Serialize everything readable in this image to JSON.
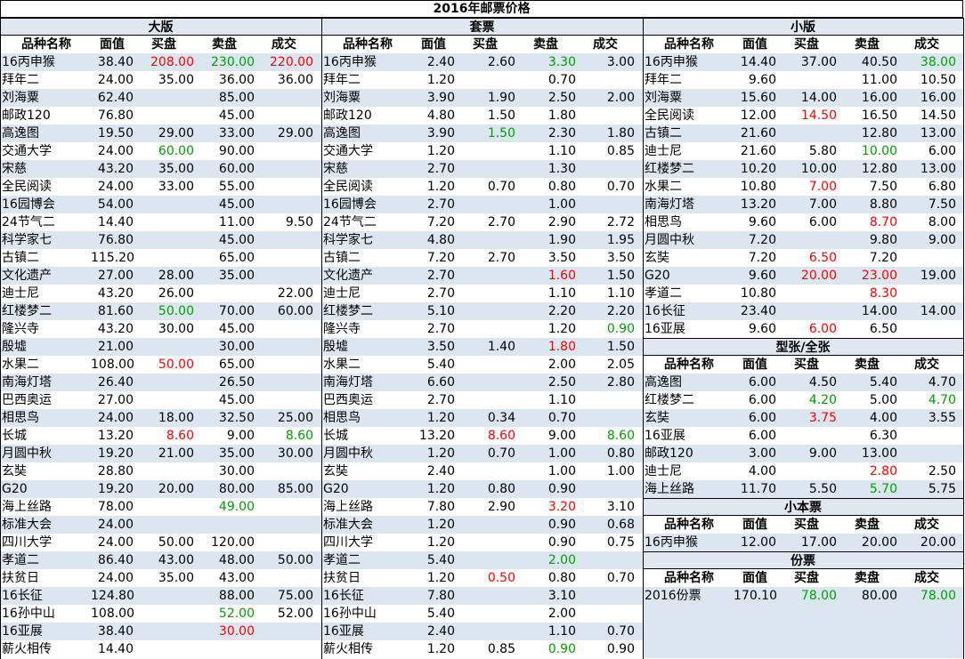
{
  "title": "2016年邮票价格",
  "headers": [
    "品种名称",
    "面值",
    "买盘",
    "卖盘",
    "成交"
  ],
  "left": {
    "section": "大版",
    "rows": [
      [
        "16丙申猴",
        "38.40",
        [
          "208.00",
          "red"
        ],
        [
          "230.00",
          "green"
        ],
        [
          "220.00",
          "red"
        ]
      ],
      [
        "拜年二",
        "24.00",
        "35.00",
        "36.00",
        "36.00"
      ],
      [
        "刘海粟",
        "62.40",
        "",
        "85.00",
        ""
      ],
      [
        "邮政120",
        "76.80",
        "",
        "45.00",
        ""
      ],
      [
        "高逸图",
        "19.50",
        "29.00",
        "33.00",
        "29.00"
      ],
      [
        "交通大学",
        "24.00",
        [
          "60.00",
          "green"
        ],
        "90.00",
        ""
      ],
      [
        "宋慈",
        "43.20",
        "35.00",
        "60.00",
        ""
      ],
      [
        "全民阅读",
        "24.00",
        "33.00",
        "55.00",
        ""
      ],
      [
        "16园博会",
        "54.00",
        "",
        "45.00",
        ""
      ],
      [
        "24节气二",
        "14.40",
        "",
        "11.00",
        "9.50"
      ],
      [
        "科学家七",
        "76.80",
        "",
        "45.00",
        ""
      ],
      [
        "古镇二",
        "115.20",
        "",
        "65.00",
        ""
      ],
      [
        "文化遗产",
        "27.00",
        "28.00",
        "35.00",
        ""
      ],
      [
        "迪士尼",
        "43.20",
        "26.00",
        "",
        "22.00"
      ],
      [
        "红楼梦二",
        "81.60",
        [
          "50.00",
          "green"
        ],
        "70.00",
        "60.00"
      ],
      [
        "隆兴寺",
        "43.20",
        "30.00",
        "45.00",
        ""
      ],
      [
        "殷墟",
        "21.00",
        "",
        "30.00",
        ""
      ],
      [
        "水果二",
        "108.00",
        [
          "50.00",
          "red"
        ],
        "65.00",
        ""
      ],
      [
        "南海灯塔",
        "26.40",
        "",
        "26.50",
        ""
      ],
      [
        "巴西奥运",
        "27.00",
        "",
        "45.00",
        ""
      ],
      [
        "相思鸟",
        "24.00",
        "18.00",
        "32.50",
        "25.00"
      ],
      [
        "长城",
        "13.20",
        [
          "8.60",
          "red"
        ],
        "9.00",
        [
          "8.60",
          "green"
        ]
      ],
      [
        "月圆中秋",
        "19.20",
        "21.00",
        "35.00",
        "30.00"
      ],
      [
        "玄奘",
        "28.80",
        "",
        "30.00",
        ""
      ],
      [
        "G20",
        "19.20",
        "20.00",
        "80.00",
        "85.00"
      ],
      [
        "海上丝路",
        "78.00",
        "",
        [
          "49.00",
          "green"
        ],
        ""
      ],
      [
        "标准大会",
        "24.00",
        "",
        "",
        ""
      ],
      [
        "四川大学",
        "24.00",
        "50.00",
        "120.00",
        ""
      ],
      [
        "孝道二",
        "86.40",
        "43.00",
        "48.00",
        "50.00"
      ],
      [
        "扶贫日",
        "24.00",
        "35.00",
        "43.00",
        ""
      ],
      [
        "16长征",
        "124.80",
        "",
        "88.00",
        "75.00"
      ],
      [
        "16孙中山",
        "108.00",
        "",
        [
          "52.00",
          "green"
        ],
        "52.00"
      ],
      [
        "16亚展",
        "38.40",
        "",
        [
          "30.00",
          "red"
        ],
        ""
      ],
      [
        "薪火相传",
        "14.40",
        "",
        "",
        ""
      ]
    ]
  },
  "middle": {
    "section": "套票",
    "rows": [
      [
        "16丙申猴",
        "2.40",
        "2.60",
        [
          "3.30",
          "green"
        ],
        "3.00"
      ],
      [
        "拜年二",
        "1.20",
        "",
        "0.70",
        ""
      ],
      [
        "刘海粟",
        "3.90",
        "1.90",
        "2.50",
        "2.00"
      ],
      [
        "邮政120",
        "4.80",
        "1.50",
        "1.80",
        ""
      ],
      [
        "高逸图",
        "3.90",
        [
          "1.50",
          "green"
        ],
        "2.30",
        "1.80"
      ],
      [
        "交通大学",
        "1.20",
        "",
        "1.10",
        "0.85"
      ],
      [
        "宋慈",
        "2.70",
        "",
        "1.30",
        ""
      ],
      [
        "全民阅读",
        "1.20",
        "0.70",
        "0.80",
        "0.70"
      ],
      [
        "16园博会",
        "2.70",
        "",
        "1.00",
        ""
      ],
      [
        "24节气二",
        "7.20",
        "2.70",
        "2.90",
        "2.72"
      ],
      [
        "科学家七",
        "4.80",
        "",
        "1.90",
        "1.95"
      ],
      [
        "古镇二",
        "7.20",
        "2.70",
        "3.50",
        "3.50"
      ],
      [
        "文化遗产",
        "2.70",
        "",
        [
          "1.60",
          "red"
        ],
        "1.50"
      ],
      [
        "迪士尼",
        "2.70",
        "",
        "1.10",
        "1.10"
      ],
      [
        "红楼梦二",
        "5.10",
        "",
        "2.20",
        "2.20"
      ],
      [
        "隆兴寺",
        "2.70",
        "",
        "1.20",
        [
          "0.90",
          "green"
        ]
      ],
      [
        "殷墟",
        "3.50",
        "1.40",
        [
          "1.80",
          "red"
        ],
        "1.50"
      ],
      [
        "水果二",
        "5.40",
        "",
        "2.00",
        "2.05"
      ],
      [
        "南海灯塔",
        "6.60",
        "",
        "2.50",
        "2.80"
      ],
      [
        "巴西奥运",
        "2.70",
        "",
        "1.10",
        ""
      ],
      [
        "相思鸟",
        "1.20",
        "0.34",
        "0.70",
        ""
      ],
      [
        "长城",
        "13.20",
        [
          "8.60",
          "red"
        ],
        "9.00",
        [
          "8.60",
          "green"
        ]
      ],
      [
        "月圆中秋",
        "1.20",
        "0.70",
        "1.00",
        "0.80"
      ],
      [
        "玄奘",
        "2.40",
        "",
        "1.00",
        "1.00"
      ],
      [
        "G20",
        "1.20",
        "0.80",
        "0.90",
        ""
      ],
      [
        "海上丝路",
        "7.80",
        "2.90",
        [
          "3.20",
          "red"
        ],
        "3.10"
      ],
      [
        "标准大会",
        "1.20",
        "",
        "0.90",
        "0.68"
      ],
      [
        "四川大学",
        "1.20",
        "",
        "0.90",
        "0.75"
      ],
      [
        "孝道二",
        "5.40",
        "",
        [
          "2.00",
          "green"
        ],
        ""
      ],
      [
        "扶贫日",
        "1.20",
        [
          "0.50",
          "red"
        ],
        "0.80",
        "0.70"
      ],
      [
        "16长征",
        "7.80",
        "",
        "3.10",
        ""
      ],
      [
        "16孙中山",
        "5.40",
        "",
        "2.00",
        ""
      ],
      [
        "16亚展",
        "2.40",
        "",
        "1.10",
        "0.70"
      ],
      [
        "薪火相传",
        "1.20",
        "0.85",
        [
          "0.90",
          "green"
        ],
        "0.90"
      ]
    ]
  },
  "right": {
    "small": {
      "section": "小版",
      "rows": [
        [
          "16丙申猴",
          "14.40",
          "37.00",
          "40.50",
          [
            "38.00",
            "green"
          ]
        ],
        [
          "拜年二",
          "9.60",
          "",
          "11.00",
          "10.50"
        ],
        [
          "刘海粟",
          "15.60",
          "14.00",
          "16.00",
          "16.00"
        ],
        [
          "全民阅读",
          "12.00",
          [
            "14.50",
            "red"
          ],
          "16.50",
          "14.50"
        ],
        [
          "古镇二",
          "21.60",
          "",
          "12.80",
          "13.00"
        ],
        [
          "迪士尼",
          "21.60",
          "5.80",
          [
            "10.00",
            "green"
          ],
          "6.00"
        ],
        [
          "红楼梦二",
          "10.20",
          "10.00",
          "12.80",
          "13.00"
        ],
        [
          "水果二",
          "10.80",
          [
            "7.00",
            "red"
          ],
          "7.50",
          "6.80"
        ],
        [
          "南海灯塔",
          "13.20",
          "7.00",
          "8.80",
          "7.50"
        ],
        [
          "相思鸟",
          "9.60",
          "6.00",
          [
            "8.70",
            "red"
          ],
          "8.00"
        ],
        [
          "月圆中秋",
          "7.20",
          "",
          "9.80",
          "9.00"
        ],
        [
          "玄奘",
          "7.20",
          [
            "6.50",
            "red"
          ],
          "7.20",
          ""
        ],
        [
          "G20",
          "9.60",
          [
            "20.00",
            "red"
          ],
          [
            "23.00",
            "red"
          ],
          "19.00"
        ],
        [
          "孝道二",
          "10.80",
          "",
          [
            "8.30",
            "red"
          ],
          ""
        ],
        [
          "16长征",
          "23.40",
          "",
          "14.00",
          "14.00"
        ],
        [
          "16亚展",
          "9.60",
          [
            "6.00",
            "red"
          ],
          "6.50",
          ""
        ]
      ]
    },
    "sheet": {
      "section": "型张/全张",
      "rows": [
        [
          "高逸图",
          "6.00",
          "4.50",
          "5.40",
          "4.70"
        ],
        [
          "红楼梦二",
          "6.00",
          [
            "4.20",
            "green"
          ],
          "5.00",
          [
            "4.70",
            "green"
          ]
        ],
        [
          "玄奘",
          "6.00",
          [
            "3.75",
            "red"
          ],
          "4.00",
          "3.55"
        ],
        [
          "16亚展",
          "6.00",
          "",
          "6.30",
          ""
        ],
        [
          "邮政120",
          "3.00",
          "9.00",
          "13.00",
          ""
        ],
        [
          "迪士尼",
          "4.00",
          "",
          [
            "2.80",
            "red"
          ],
          "2.50"
        ],
        [
          "海上丝路",
          "11.70",
          "5.50",
          [
            "5.70",
            "green"
          ],
          "5.75"
        ]
      ]
    },
    "booklet": {
      "section": "小本票",
      "rows": [
        [
          "16丙申猴",
          "12.00",
          "17.00",
          "20.00",
          "20.00"
        ]
      ]
    },
    "annual": {
      "section": "份票",
      "rows": [
        [
          "2016份票",
          "170.10",
          [
            "78.00",
            "green"
          ],
          "80.00",
          [
            "78.00",
            "green"
          ]
        ]
      ]
    }
  }
}
